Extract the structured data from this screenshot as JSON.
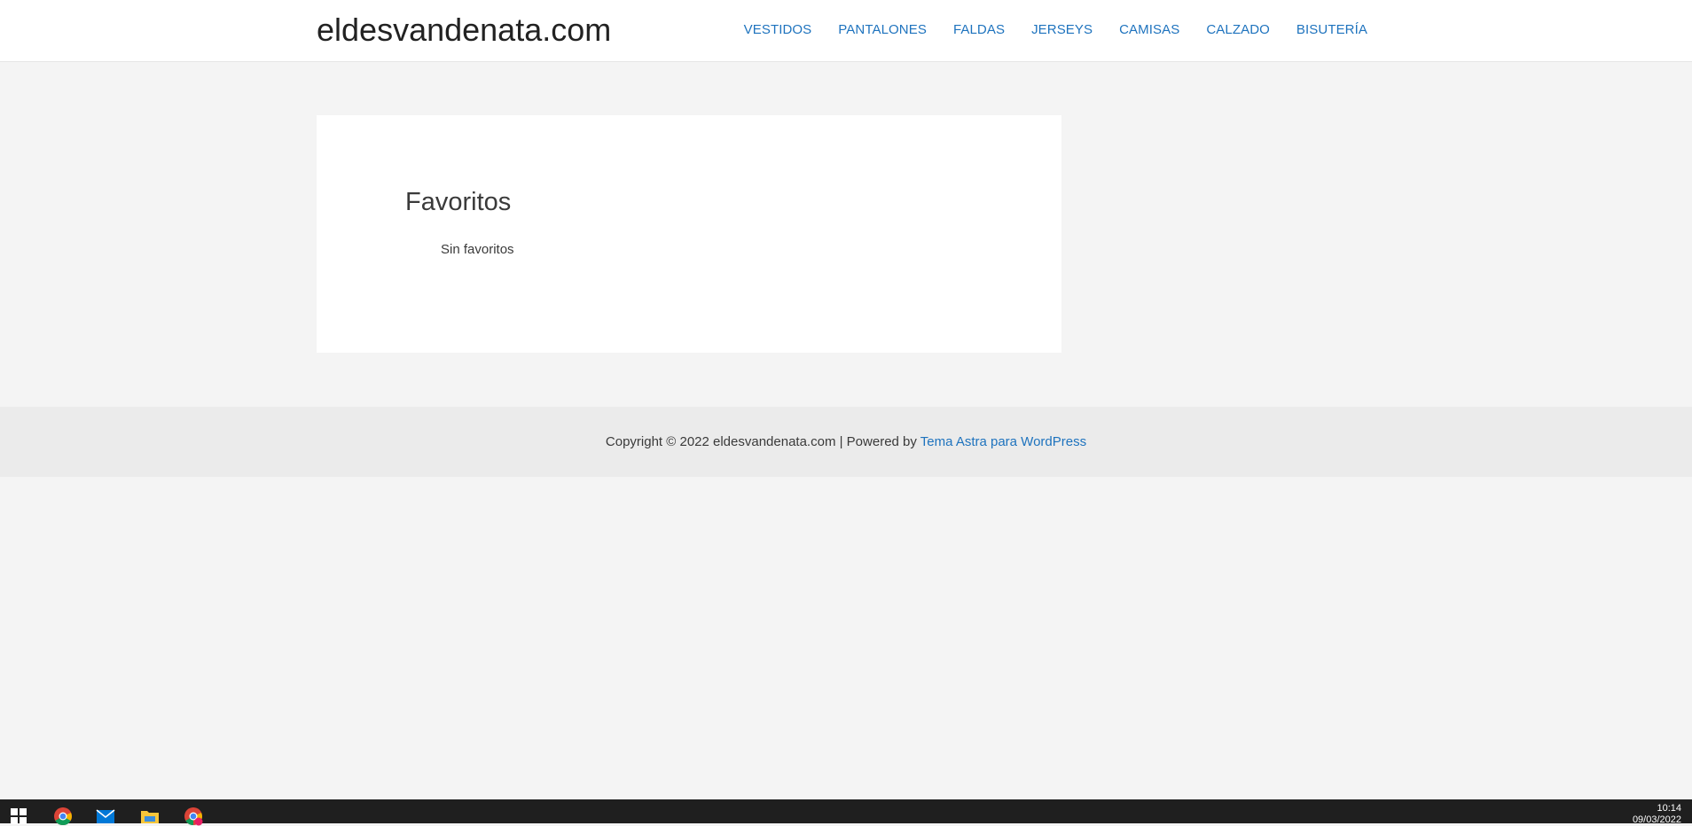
{
  "header": {
    "site_title": "eldesvandenata.com",
    "nav": [
      "VESTIDOS",
      "PANTALONES",
      "FALDAS",
      "JERSEYS",
      "CAMISAS",
      "CALZADO",
      "BISUTERÍA"
    ]
  },
  "main": {
    "page_title": "Favoritos",
    "empty_message": "Sin favoritos"
  },
  "footer": {
    "text": "Copyright © 2022 eldesvandenata.com | Powered by",
    "link_text": "Tema Astra para WordPress"
  },
  "taskbar": {
    "icons": [
      "windows-start-icon",
      "chrome-icon",
      "mail-icon",
      "file-explorer-icon",
      "chrome-profile-icon"
    ],
    "time": "10:14",
    "date": "09/03/2022"
  },
  "colors": {
    "link": "#1e73be",
    "page_background": "#f4f4f4",
    "footer_background": "#ebebeb",
    "taskbar": "#1f1f1f"
  }
}
